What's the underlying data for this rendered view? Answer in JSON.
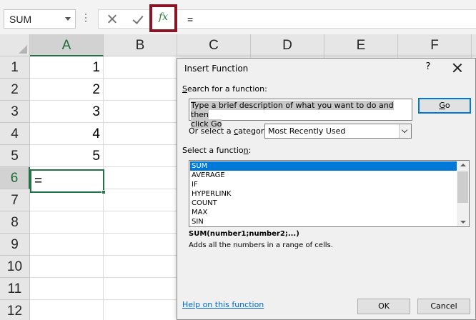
{
  "formula_bar": {
    "name_box": "SUM",
    "fx_label": "fx",
    "formula": "="
  },
  "grid": {
    "columns": [
      "A",
      "B",
      "C",
      "D",
      "E",
      "F"
    ],
    "rows": [
      "1",
      "2",
      "3",
      "4",
      "5",
      "6",
      "7",
      "8",
      "9",
      "10",
      "11",
      "12"
    ],
    "a_values": [
      "1",
      "2",
      "3",
      "4",
      "5"
    ],
    "active_cell_value": "="
  },
  "dialog": {
    "title": "Insert Function",
    "help": "?",
    "search_label_u": "S",
    "search_label_rest": "earch for a function:",
    "search_value_1": "Type a brief description of what you want to do and then",
    "search_value_2": "click Go",
    "go_label_u": "G",
    "go_label_rest": "o",
    "category_label_pre": "Or select a ",
    "category_label_u": "c",
    "category_label_post": "ategory:",
    "category_value": "Most Recently Used",
    "function_label_pre": "Select a functio",
    "function_label_u": "n",
    "function_label_post": ":",
    "functions": [
      "SUM",
      "AVERAGE",
      "IF",
      "HYPERLINK",
      "COUNT",
      "MAX",
      "SIN"
    ],
    "syntax": "SUM(number1;number2;...)",
    "description": "Adds all the numbers in a range of cells.",
    "help_link": "Help on this function",
    "ok_label": "OK",
    "cancel_label": "Cancel"
  }
}
